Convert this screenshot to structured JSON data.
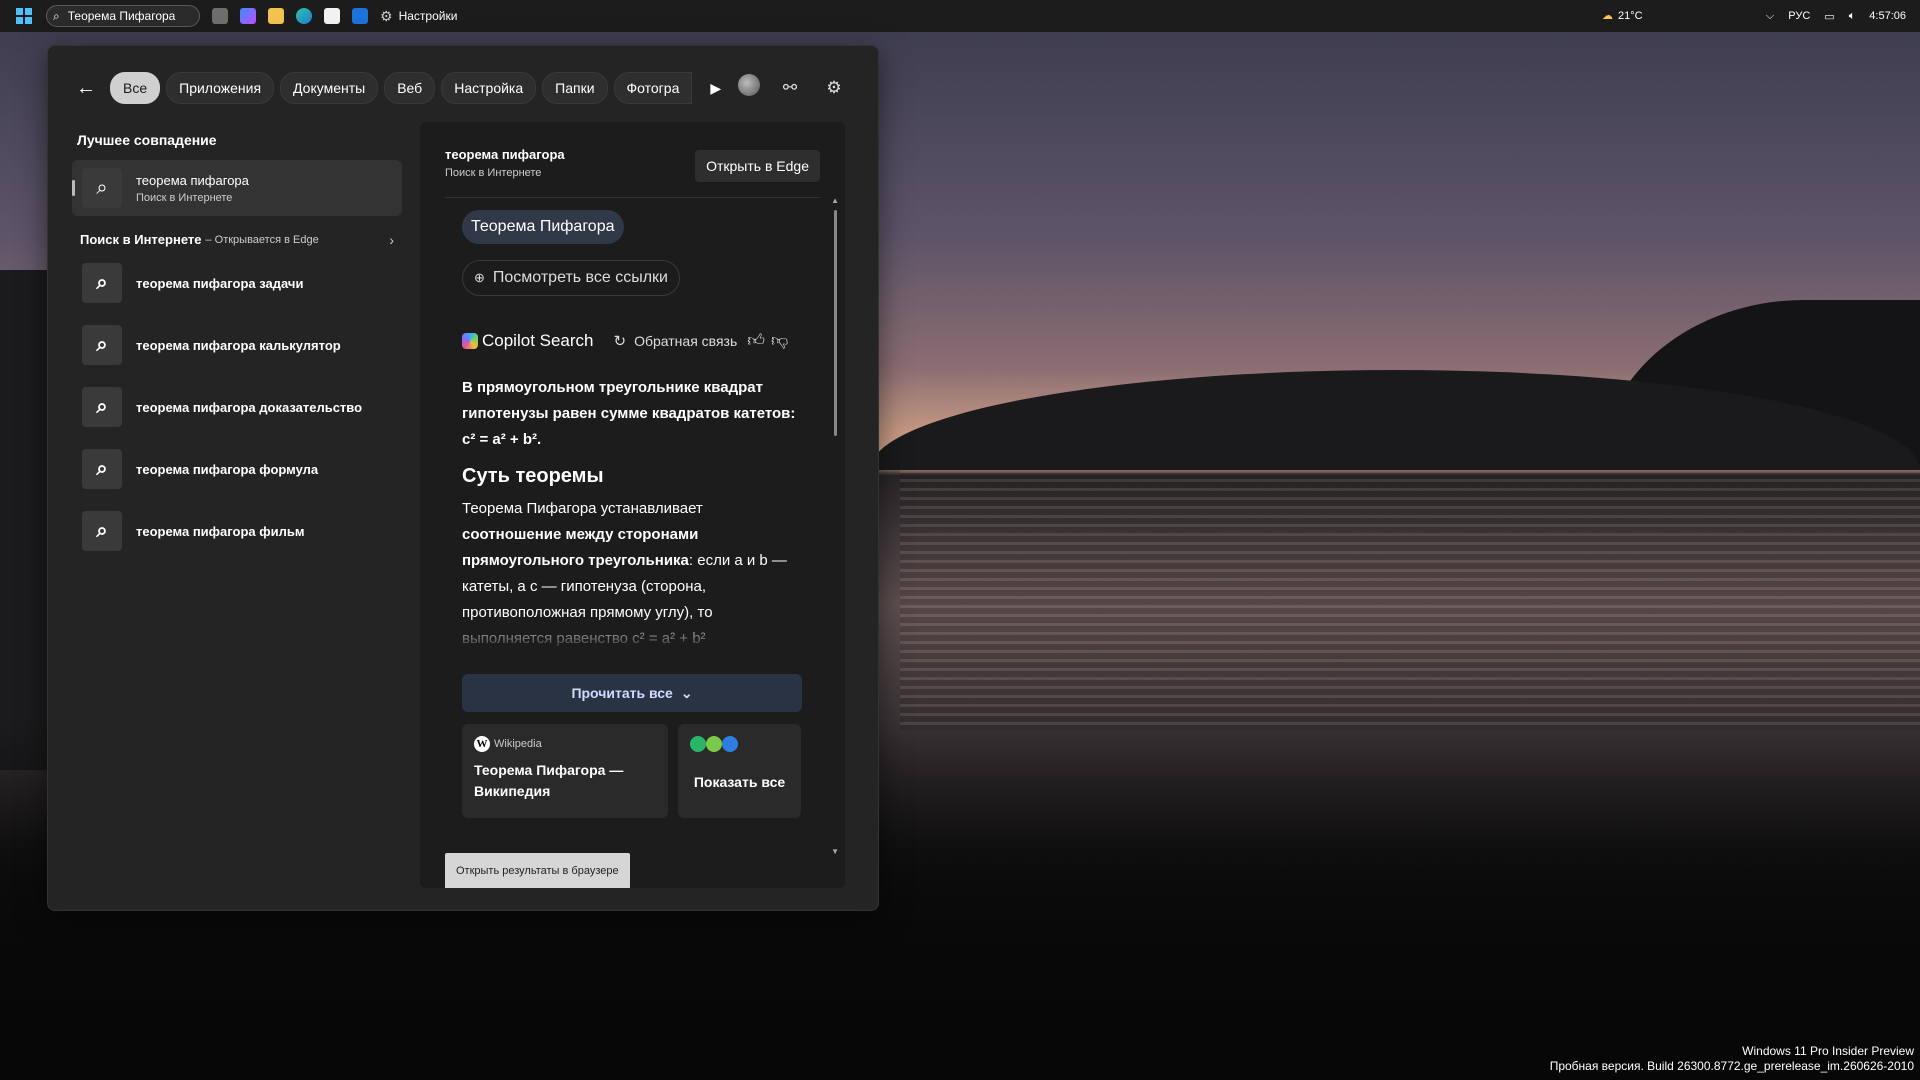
{
  "taskbar": {
    "search_value": "Теорема Пифагора",
    "settings_label": "Настройки",
    "weather": "21°C",
    "language": "РУС",
    "time": "4:57:06"
  },
  "filters": {
    "items": [
      "Все",
      "Приложения",
      "Документы",
      "Веб",
      "Настройка",
      "Папки",
      "Фотогра"
    ]
  },
  "left": {
    "best_match_title": "Лучшее совпадение",
    "best_match": {
      "title": "теорема пифагора",
      "subtitle": "Поиск в Интернете"
    },
    "web_section": {
      "title": "Поиск в Интернете",
      "subtitle": "– Открывается в Edge"
    },
    "suggestions": [
      {
        "prefix": "теорема пифагора ",
        "bold": "задачи"
      },
      {
        "prefix": "теорема пифагора ",
        "bold": "калькулятор"
      },
      {
        "prefix": "теорема пифагора ",
        "bold": "доказательство"
      },
      {
        "prefix": "теорема пифагора ",
        "bold": "формула"
      },
      {
        "prefix": "теорема пифагора ",
        "bold": "фильм"
      }
    ]
  },
  "preview": {
    "title": "теорема пифагора",
    "subtitle": "Поиск в Интернете",
    "open_edge": "Открыть в Edge",
    "query_pill": "Теорема Пифагора",
    "links_pill": "Посмотреть все ссылки",
    "copilot_name": "Copilot Search",
    "feedback": "Обратная связь",
    "answer_lead": "В прямоугольном треугольнике квадрат гипотенузы равен сумме квадратов катетов: c² = a² + b².",
    "answer_heading": "Суть теоремы",
    "answer_body_1": "Теорема Пифагора устанавливает ",
    "answer_body_bold": "соотношение между сторонами прямоугольного треугольника",
    "answer_body_2": ": если a и b — катеты, а c — гипотенуза (сторона, противоположная прямому углу), то выполняется равенство c² = a² + b²",
    "read_all": "Прочитать все",
    "wiki_source": "Wikipedia",
    "wiki_title": "Теорема Пифагора — Википедия",
    "show_all": "Показать все",
    "open_browser": "Открыть результаты в браузере"
  },
  "watermark": {
    "line1": "Windows 11 Pro Insider Preview",
    "line2": "Пробная версия. Build 26300.8772.ge_prerelease_im.260626-2010"
  },
  "colors": {
    "accent": "#4cc2ff",
    "panel": "#242424",
    "preview": "#1c1c1c",
    "read_all": "#2a3344"
  }
}
